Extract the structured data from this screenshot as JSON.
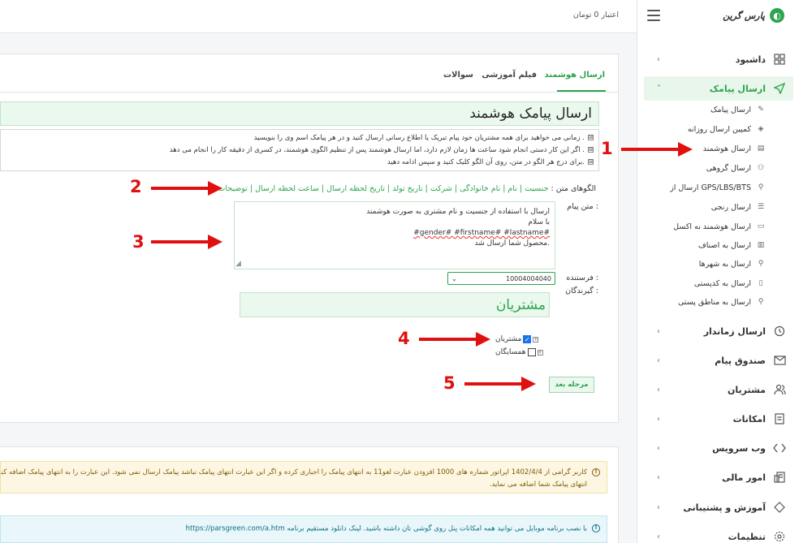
{
  "brand": {
    "name": "پارس گرین"
  },
  "topbar": {
    "credit": "اعتبار 0 تومان"
  },
  "menu": {
    "items": [
      {
        "label": "داشبود",
        "icon": "dashboard-icon"
      },
      {
        "label": "ارسال پیامک",
        "icon": "send-icon"
      },
      {
        "label": "ارسال زماندار",
        "icon": "clock-icon"
      },
      {
        "label": "صندوق پیام",
        "icon": "mail-icon"
      },
      {
        "label": "مشتریان",
        "icon": "users-icon"
      },
      {
        "label": "امکانات",
        "icon": "document-icon"
      },
      {
        "label": "وب سرویس",
        "icon": "code-icon"
      },
      {
        "label": "امور مالی",
        "icon": "finance-icon"
      },
      {
        "label": "آموزش و پشتیبانی",
        "icon": "support-icon"
      },
      {
        "label": "تنظیمات",
        "icon": "gear-icon"
      }
    ],
    "sub_items": [
      {
        "label": "ارسال پیامک",
        "icon": "edit-icon"
      },
      {
        "label": "کمپین ارسال روزانه",
        "icon": "layers-icon"
      },
      {
        "label": "ارسال هوشمند",
        "icon": "smart-icon"
      },
      {
        "label": "ارسال گروهی",
        "icon": "group-icon"
      },
      {
        "label": "ارسال از GPS/LBS/BTS",
        "icon": "location-icon"
      },
      {
        "label": "ارسال رنجی",
        "icon": "list-icon"
      },
      {
        "label": "ارسال هوشمند به اکسل",
        "icon": "excel-icon"
      },
      {
        "label": "ارسال به اصناف",
        "icon": "building-icon"
      },
      {
        "label": "ارسال به شهرها",
        "icon": "city-icon"
      },
      {
        "label": "ارسال به کدپستی",
        "icon": "map-icon"
      },
      {
        "label": "ارسال به مناطق پستی",
        "icon": "region-icon"
      }
    ]
  },
  "tabs": [
    "ارسال هوشمند",
    "فیلم آموزشی",
    "سوالات"
  ],
  "page": {
    "title": "ارسال پیامک هوشمند",
    "info": [
      "زمانی می خواهید برای همه مشتریان خود پیام تبریک یا اطلاع رسانی ارسال کنید و در هر پیامک اسم وی را بنویسید .",
      "اگر این کار دستی انجام شود ساعت ها زمان لازم دارد، اما ارسال هوشمند پس از تنظیم الگوی هوشمند، در کسری از دقیقه کار را انجام می دهد .",
      "برای درج هر الگو در متن، روی آن الگو کلیک کنید و سپس ادامه دهید."
    ],
    "patterns_label": "الگوهای متن :",
    "patterns": "جنسیت | نام | نام خانوادگی | شرکت | تاریخ تولد | تاریخ لحظه ارسال | ساعت لحظه ارسال | توضیحات",
    "message_label": "متن پیام :",
    "message_lines": [
      "ارسال با استفاده از جنسیت و نام مشتری به صورت هوشمند",
      "با سلام",
      "#gender# #firstname# #lastname#",
      "محصول شما ارسال شد."
    ],
    "sender_label": "فرستنده :",
    "sender_value": "10004004040",
    "recipients_label": "گیرندگان :",
    "recipients_group": "مشتریان",
    "tree": [
      {
        "label": "مشتریان",
        "checked": true
      },
      {
        "label": "همسایگان",
        "checked": false
      }
    ],
    "next_button": "مرحله بعد"
  },
  "annotations": [
    "1",
    "2",
    "3",
    "4",
    "5"
  ],
  "notices": {
    "warning_line1": "کاربر گرامی از 1402/4/4 اپراتور شماره های 1000 افزودن عبارت لغو11 به انتهای پیامک را اجباری کرده و اگر این عبارت انتهای پیامک نباشد پیامک ارسال نمی شود. این عبارت را به انتهای پیامک اضافه کنید",
    "warning_line2": "انتهای پیامک شما اضافه می نماید.",
    "tip": "با نصب برنامه موبایل می توانید همه امکانات پنل روی گوشی تان داشته باشید. لینک دانلود مستقیم برنامه https://parsgreen.com/a.htm"
  },
  "colors": {
    "accent": "#2da44e",
    "annotation": "#e01010"
  }
}
